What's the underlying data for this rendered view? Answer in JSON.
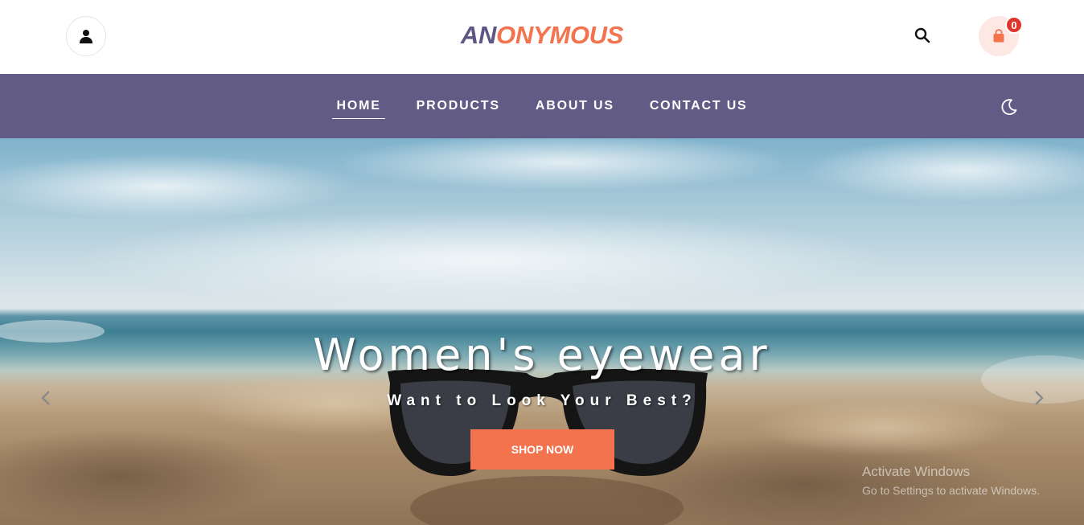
{
  "header": {
    "logo_part1": "AN",
    "logo_part2": "ONYMOUS",
    "cart_count": "0",
    "icons": {
      "user": "user-icon",
      "search": "search-icon",
      "cart": "shopping-bag-icon",
      "theme": "moon-icon"
    }
  },
  "nav": {
    "items": [
      {
        "label": "HOME",
        "active": true
      },
      {
        "label": "PRODUCTS"
      },
      {
        "label": "ABOUT US"
      },
      {
        "label": "CONTACT US"
      }
    ]
  },
  "hero": {
    "title": "Women's eyewear",
    "subtitle": "Want to Look Your Best?",
    "button_label": "SHOP NOW"
  },
  "watermark": {
    "line1": "Activate Windows",
    "line2": "Go to Settings to activate Windows."
  },
  "colors": {
    "brand_dark": "#5d5883",
    "accent": "#f4734f",
    "nav_bg": "#615b86",
    "badge": "#e0352b"
  }
}
